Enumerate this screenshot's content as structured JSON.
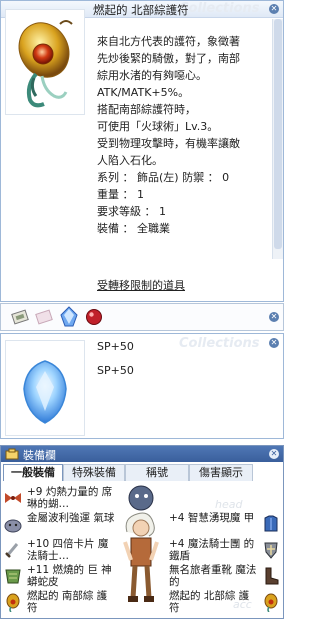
{
  "item_window": {
    "title": "燃起的 北部綜護符",
    "watermark": "Collections",
    "description_lines": [
      "來自北方代表的護符，象徵著",
      "先炒後緊的騎傲，對了，南部",
      "綜用水渚的有夠噁心。",
      "ATK/MATK+5%。",
      "搭配南部綜護符時，",
      "可使用「火球術」Lv.3。",
      "受到物理攻擊時，有機率讓敵",
      "人陷入石化。",
      "系列 ： 飾品(左) 防禦 ： 0",
      "重量 ： 1",
      "要求等級 ： 1",
      "裝備 ： 全職業"
    ],
    "trade_restriction": "受轉移限制的道具"
  },
  "card_window": {
    "watermark": "Collections",
    "title_line": "SP+50",
    "body_line": "SP+50"
  },
  "equipment_window": {
    "title": "裝備欄",
    "tabs": [
      "一般裝備",
      "特殊裝備",
      "稱號",
      "傷害顯示"
    ],
    "left_items": [
      {
        "text": "+9 灼熱力量的 席琳的蝴…",
        "icon": "bow-tie-icon"
      },
      {
        "text": "金屬波利強運 氣球",
        "icon": "metal-poring-icon"
      },
      {
        "text": "+10 四倍卡片 魔法騎士…",
        "icon": "dagger-icon"
      },
      {
        "text": "+11 燃燒的 巨 神蟒蛇皮",
        "icon": "snakeskin-icon"
      },
      {
        "text": "燃起的 南部綜 護符",
        "icon": "amulet-icon"
      }
    ],
    "right_items": [
      {
        "text": "+4 智慧湧現魔 甲",
        "icon": "armor-icon"
      },
      {
        "text": "+4 魔法騎士團 的 鐵盾",
        "icon": "shield-icon"
      },
      {
        "text": "無名旅者重靴 魔法的",
        "icon": "boots-icon"
      },
      {
        "text": "燃起的 北部綜 護符",
        "icon": "amulet-icon"
      }
    ],
    "ghost_labels": [
      "head",
      "acc"
    ]
  },
  "colors": {
    "accent": "#3a5f9c",
    "panel_border": "#9eb8d8",
    "link": "#222222"
  }
}
